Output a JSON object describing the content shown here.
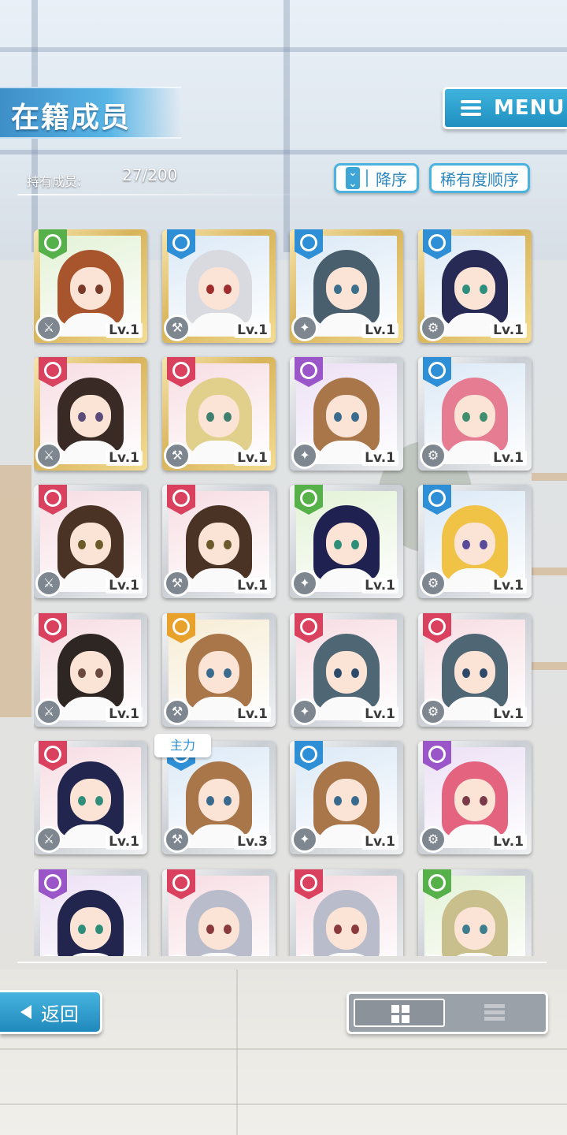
{
  "header": {
    "title": "在籍成员",
    "menu_label": "MENU",
    "member_count_label": "持有成员:",
    "member_count": "27/200",
    "sort_order_label": "降序",
    "sort_key_label": "稀有度顺序"
  },
  "main_tag": "主力",
  "cards": [
    {
      "frame": "gold",
      "attr": "green",
      "level": "Lv.1",
      "hair": "#a8552e",
      "eyes": "#7a3a2a"
    },
    {
      "frame": "gold",
      "attr": "blue",
      "level": "Lv.1",
      "hair": "#d9d9e0",
      "eyes": "#a02d2d"
    },
    {
      "frame": "gold",
      "attr": "blue",
      "level": "Lv.1",
      "hair": "#4a5f6e",
      "eyes": "#3b6f8c"
    },
    {
      "frame": "gold",
      "attr": "blue",
      "level": "Lv.1",
      "hair": "#262a55",
      "eyes": "#2f8f7f"
    },
    {
      "frame": "gold",
      "attr": "red",
      "level": "Lv.1",
      "hair": "#3a2a25",
      "eyes": "#5b4a7a"
    },
    {
      "frame": "gold",
      "attr": "red",
      "level": "Lv.1",
      "hair": "#e1cf8c",
      "eyes": "#3e7f6f"
    },
    {
      "frame": "silver",
      "attr": "purple",
      "level": "Lv.1",
      "hair": "#a9764a",
      "eyes": "#3a6a8e"
    },
    {
      "frame": "silver",
      "attr": "blue",
      "level": "Lv.1",
      "hair": "#e57c92",
      "eyes": "#3e8e6f"
    },
    {
      "frame": "silver",
      "attr": "red",
      "level": "Lv.1",
      "hair": "#4a3324",
      "eyes": "#6b5a2a"
    },
    {
      "frame": "silver",
      "attr": "red",
      "level": "Lv.1",
      "hair": "#4a3324",
      "eyes": "#6b5a2a"
    },
    {
      "frame": "silver",
      "attr": "green",
      "level": "Lv.1",
      "hair": "#1f2250",
      "eyes": "#2e8e7a"
    },
    {
      "frame": "silver",
      "attr": "blue",
      "level": "Lv.1",
      "hair": "#f0c245",
      "eyes": "#5a4a9a"
    },
    {
      "frame": "silver",
      "attr": "red",
      "level": "Lv.1",
      "hair": "#2e2622",
      "eyes": "#6a4a40"
    },
    {
      "frame": "silver",
      "attr": "orange",
      "level": "Lv.1",
      "hair": "#a9764a",
      "eyes": "#3a6a8e"
    },
    {
      "frame": "silver",
      "attr": "red",
      "level": "Lv.1",
      "hair": "#4f6675",
      "eyes": "#2e4a6a"
    },
    {
      "frame": "silver",
      "attr": "red",
      "level": "Lv.1",
      "hair": "#4f6675",
      "eyes": "#2e4a6a"
    },
    {
      "frame": "silver",
      "attr": "red",
      "level": "Lv.1",
      "hair": "#22264f",
      "eyes": "#2e8e7a"
    },
    {
      "frame": "silver",
      "attr": "blue",
      "level": "Lv.3",
      "hair": "#a9764a",
      "eyes": "#3a6a8e"
    },
    {
      "frame": "silver",
      "attr": "blue",
      "level": "Lv.1",
      "hair": "#a9764a",
      "eyes": "#3a6a8e"
    },
    {
      "frame": "silver",
      "attr": "purple",
      "level": "Lv.1",
      "hair": "#e4637f",
      "eyes": "#7a3a4a"
    },
    {
      "frame": "silver",
      "attr": "purple",
      "level": "",
      "hair": "#22264f",
      "eyes": "#2e8e7a"
    },
    {
      "frame": "silver",
      "attr": "red",
      "level": "",
      "hair": "#b8bccb",
      "eyes": "#8a3a3a"
    },
    {
      "frame": "silver",
      "attr": "red",
      "level": "",
      "hair": "#b8bccb",
      "eyes": "#8a3a3a"
    },
    {
      "frame": "silver",
      "attr": "green",
      "level": "",
      "hair": "#c9bf8d",
      "eyes": "#3e7f8f"
    }
  ],
  "attr_colors": {
    "green": "#56b14a",
    "blue": "#2f8fd6",
    "red": "#d9415f",
    "purple": "#9a56c8",
    "orange": "#e8a12a"
  },
  "footer": {
    "back_label": "返回"
  }
}
